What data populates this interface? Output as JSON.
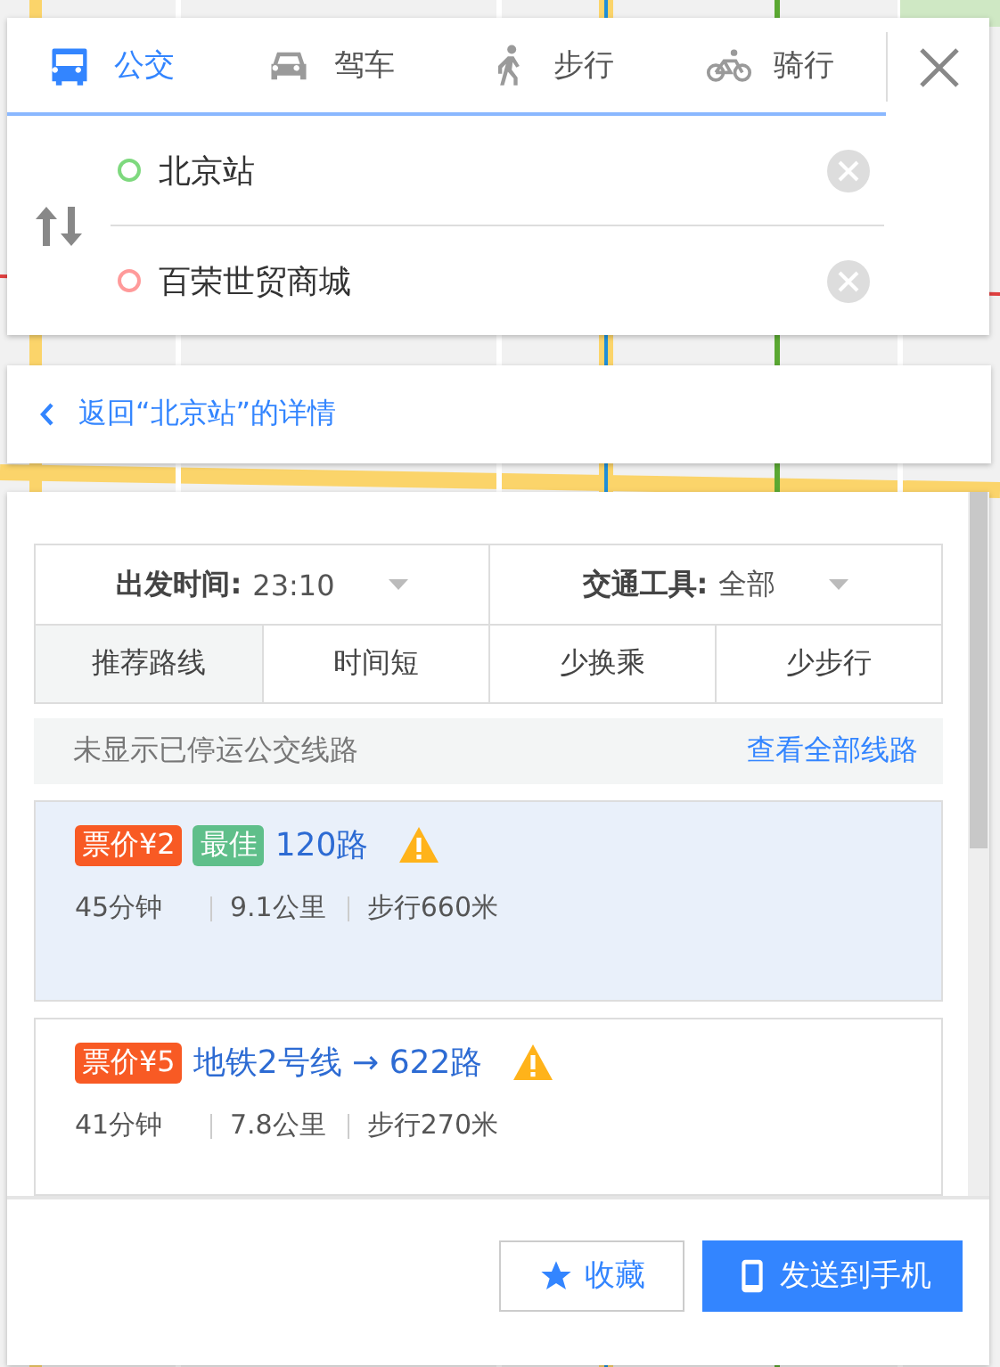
{
  "tabs": [
    {
      "kind": "bus",
      "label": "公交",
      "selected": true
    },
    {
      "kind": "car",
      "label": "驾车",
      "selected": false
    },
    {
      "kind": "walk",
      "label": "步行",
      "selected": false
    },
    {
      "kind": "bike",
      "label": "骑行",
      "selected": false
    }
  ],
  "route_inputs": [
    {
      "kind": "start",
      "value": "北京站"
    },
    {
      "kind": "end",
      "value": "百荣世贸商城"
    }
  ],
  "back_link": "返回“北京站”的详情",
  "filters": [
    {
      "label": "出发时间:",
      "value": "23:10"
    },
    {
      "label": "交通工具:",
      "value": "全部"
    }
  ],
  "sort_tabs": [
    {
      "label": "推荐路线",
      "selected": true
    },
    {
      "label": "时间短",
      "selected": false
    },
    {
      "label": "少换乘",
      "selected": false
    },
    {
      "label": "少步行",
      "selected": false
    }
  ],
  "notice": {
    "text": "未显示已停运公交线路",
    "link": "查看全部线路"
  },
  "routes": [
    {
      "fare": "票价¥2",
      "best": "最佳",
      "line": "120路",
      "warning": true,
      "selected": true,
      "stats": [
        "45分钟",
        "9.1公里",
        "步行660米"
      ]
    },
    {
      "fare": "票价¥5",
      "line": "地铁2号线 → 622路",
      "warning": true,
      "selected": false,
      "stats": [
        "41分钟",
        "7.8公里",
        "步行270米"
      ]
    }
  ],
  "buttons": [
    {
      "kind": "favorite",
      "label": "收藏"
    },
    {
      "kind": "send",
      "label": "发送到手机"
    }
  ]
}
